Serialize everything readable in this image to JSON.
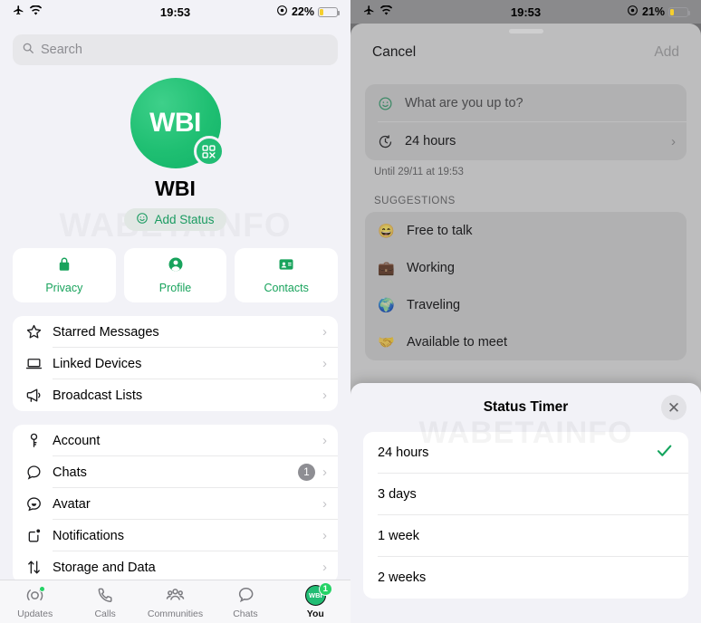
{
  "left": {
    "statusbar": {
      "airplane_icon": "airplane-icon",
      "wifi_icon": "wifi-icon",
      "time": "19:53",
      "focus_icon": "focus-icon",
      "battery_text": "22%",
      "battery_level": 22
    },
    "search": {
      "placeholder": "Search",
      "value": "",
      "icon": "search-icon"
    },
    "watermark": "WABETAINFO",
    "profile": {
      "avatar_text": "WBI",
      "qr_icon": "qr-code-icon",
      "name": "WBI",
      "add_status_label": "Add Status",
      "add_status_icon": "smiley-icon"
    },
    "quick_actions": [
      {
        "label": "Privacy",
        "icon": "lock-icon"
      },
      {
        "label": "Profile",
        "icon": "person-circle-icon"
      },
      {
        "label": "Contacts",
        "icon": "contact-card-icon"
      }
    ],
    "group_one": [
      {
        "label": "Starred Messages",
        "icon": "star-icon",
        "badge": ""
      },
      {
        "label": "Linked Devices",
        "icon": "laptop-icon",
        "badge": ""
      },
      {
        "label": "Broadcast Lists",
        "icon": "megaphone-icon",
        "badge": ""
      }
    ],
    "group_two": [
      {
        "label": "Account",
        "icon": "key-icon",
        "badge": ""
      },
      {
        "label": "Chats",
        "icon": "chat-bubble-icon",
        "badge": "1"
      },
      {
        "label": "Avatar",
        "icon": "avatar-icon",
        "badge": ""
      },
      {
        "label": "Notifications",
        "icon": "notification-icon",
        "badge": ""
      },
      {
        "label": "Storage and Data",
        "icon": "arrows-updown-icon",
        "badge": ""
      }
    ],
    "tabs": [
      {
        "label": "Updates",
        "icon": "updates-icon",
        "active": false,
        "dot": true,
        "badge": ""
      },
      {
        "label": "Calls",
        "icon": "phone-icon",
        "active": false,
        "dot": false,
        "badge": ""
      },
      {
        "label": "Communities",
        "icon": "communities-icon",
        "active": false,
        "dot": false,
        "badge": ""
      },
      {
        "label": "Chats",
        "icon": "chats-icon",
        "active": false,
        "dot": false,
        "badge": ""
      },
      {
        "label": "You",
        "icon": "you-avatar-icon",
        "active": true,
        "dot": false,
        "badge": "1",
        "avatar_text": "WBI"
      }
    ]
  },
  "right": {
    "statusbar": {
      "airplane_icon": "airplane-icon",
      "wifi_icon": "wifi-icon",
      "time": "19:53",
      "focus_icon": "focus-icon",
      "battery_text": "21%",
      "battery_level": 21
    },
    "sheet": {
      "cancel_label": "Cancel",
      "add_label": "Add",
      "status_placeholder": "What are you up to?",
      "status_icon": "smiley-icon",
      "timer_label": "24 hours",
      "timer_icon": "timer-icon",
      "until_text": "Until 29/11 at 19:53",
      "suggestions_title": "SUGGESTIONS",
      "suggestions": [
        {
          "emoji": "😄",
          "label": "Free to talk"
        },
        {
          "emoji": "💼",
          "label": "Working"
        },
        {
          "emoji": "🌍",
          "label": "Traveling"
        },
        {
          "emoji": "🤝",
          "label": "Available to meet"
        }
      ]
    },
    "timer_sheet": {
      "title": "Status Timer",
      "close_icon": "close-icon",
      "watermark": "WABETAINFO",
      "options": [
        {
          "label": "24 hours",
          "selected": true
        },
        {
          "label": "3 days",
          "selected": false
        },
        {
          "label": "1 week",
          "selected": false
        },
        {
          "label": "2 weeks",
          "selected": false
        }
      ]
    }
  },
  "colors": {
    "brand_green": "#21bd74",
    "accent_green": "#25d366",
    "badge_gray": "#8e8e93",
    "battery_yellow": "#f5cf2e"
  }
}
